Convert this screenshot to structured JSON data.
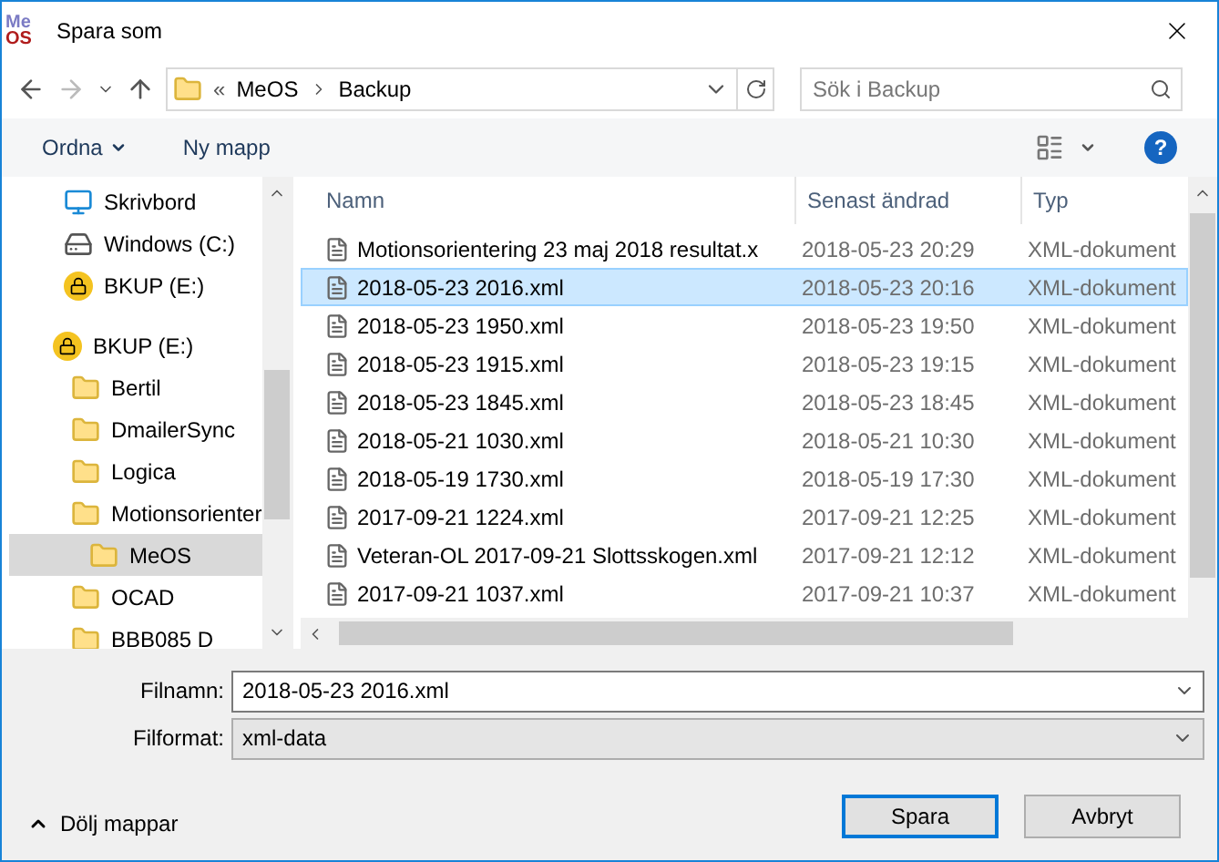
{
  "window": {
    "title": "Spara som",
    "logo": {
      "top": "Me",
      "bottom": "OS"
    }
  },
  "address": {
    "overflow": "«",
    "crumbs": [
      "MeOS",
      "Backup"
    ]
  },
  "search": {
    "placeholder": "Sök i Backup"
  },
  "toolbar": {
    "organize": "Ordna",
    "new_folder": "Ny mapp",
    "help": "?"
  },
  "sidebar": {
    "items": [
      {
        "label": "Skrivbord",
        "kind": "desktop",
        "selected": false
      },
      {
        "label": "Windows (C:)",
        "kind": "drive",
        "selected": false
      },
      {
        "label": "BKUP (E:)",
        "kind": "locked",
        "selected": false
      },
      {
        "label": "BKUP (E:)",
        "kind": "locked",
        "selected": false,
        "children": [
          {
            "label": "Bertil",
            "kind": "folder",
            "selected": false
          },
          {
            "label": "DmailerSync",
            "kind": "folder",
            "selected": false
          },
          {
            "label": "Logica",
            "kind": "folder",
            "selected": false
          },
          {
            "label": "Motionsorienter",
            "kind": "folder",
            "selected": false,
            "children": [
              {
                "label": "MeOS",
                "kind": "folder",
                "selected": true
              }
            ]
          },
          {
            "label": "OCAD",
            "kind": "folder",
            "selected": false
          },
          {
            "label": "BBB085 D",
            "kind": "folder",
            "selected": false
          }
        ]
      }
    ]
  },
  "table": {
    "columns": [
      "Namn",
      "Senast ändrad",
      "Typ"
    ],
    "rows": [
      {
        "name": "Motionsorientering 23 maj 2018 resultat.x",
        "modified": "2018-05-23 20:29",
        "type": "XML-dokument",
        "selected": false
      },
      {
        "name": "2018-05-23 2016.xml",
        "modified": "2018-05-23 20:16",
        "type": "XML-dokument",
        "selected": true
      },
      {
        "name": "2018-05-23 1950.xml",
        "modified": "2018-05-23 19:50",
        "type": "XML-dokument",
        "selected": false
      },
      {
        "name": "2018-05-23 1915.xml",
        "modified": "2018-05-23 19:15",
        "type": "XML-dokument",
        "selected": false
      },
      {
        "name": "2018-05-23 1845.xml",
        "modified": "2018-05-23 18:45",
        "type": "XML-dokument",
        "selected": false
      },
      {
        "name": "2018-05-21 1030.xml",
        "modified": "2018-05-21 10:30",
        "type": "XML-dokument",
        "selected": false
      },
      {
        "name": "2018-05-19 1730.xml",
        "modified": "2018-05-19 17:30",
        "type": "XML-dokument",
        "selected": false
      },
      {
        "name": "2017-09-21 1224.xml",
        "modified": "2017-09-21 12:25",
        "type": "XML-dokument",
        "selected": false
      },
      {
        "name": "Veteran-OL 2017-09-21 Slottsskogen.xml",
        "modified": "2017-09-21 12:12",
        "type": "XML-dokument",
        "selected": false
      },
      {
        "name": "2017-09-21 1037.xml",
        "modified": "2017-09-21 10:37",
        "type": "XML-dokument",
        "selected": false
      }
    ]
  },
  "filename": {
    "label": "Filnamn:",
    "value": "2018-05-23 2016.xml"
  },
  "format": {
    "label": "Filformat:",
    "value": "xml-data"
  },
  "hide_folders": "Dölj mappar",
  "buttons": [
    {
      "label": "Spara",
      "default": true
    },
    {
      "label": "Avbryt",
      "default": false
    }
  ]
}
